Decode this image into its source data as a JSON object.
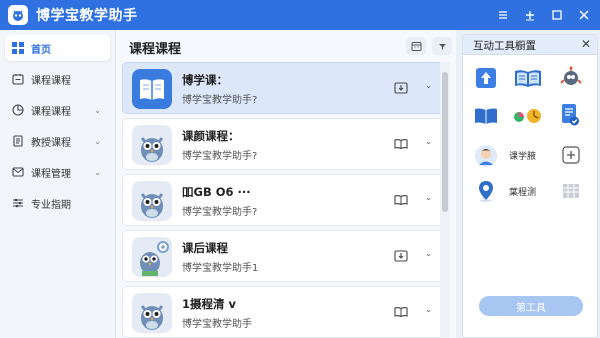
{
  "app": {
    "title": "博学宝教学助手"
  },
  "window_controls": [
    "menu-icon",
    "new-icon",
    "minimize-icon",
    "maximize-icon",
    "close-icon"
  ],
  "sidebar": {
    "items": [
      {
        "label": "首页",
        "icon": "grid-icon",
        "active": true,
        "has_chevron": false
      },
      {
        "label": "课程课程",
        "icon": "calendar-icon",
        "active": false,
        "has_chevron": false
      },
      {
        "label": "课程课程",
        "icon": "pie-chart-icon",
        "active": false,
        "has_chevron": true
      },
      {
        "label": "教授课程",
        "icon": "document-icon",
        "active": false,
        "has_chevron": true
      },
      {
        "label": "课程管理",
        "icon": "mail-icon",
        "active": false,
        "has_chevron": true
      },
      {
        "label": "专业指期",
        "icon": "sliders-icon",
        "active": false,
        "has_chevron": false
      }
    ]
  },
  "main": {
    "title": "课程课程",
    "cards": [
      {
        "title": "博学课：",
        "subtitle": "博学宝教学助手?",
        "thumb": "book-icon",
        "action": "download-icon",
        "active": true
      },
      {
        "title": "课颜课程：",
        "subtitle": "博学宝教学助手?",
        "thumb": "owl-mascot",
        "action": "open-book-icon",
        "active": false
      },
      {
        "title": "吅GB O6 ···",
        "subtitle": "博学宝教学助手?",
        "thumb": "owl-mascot",
        "action": "open-book-icon",
        "active": false
      },
      {
        "title": "课后课程",
        "subtitle": "博学宝教学助手1",
        "thumb": "owl-gear-mascot",
        "action": "download-icon",
        "active": false
      },
      {
        "title": "1摄程清 ⅴ",
        "subtitle": "博学宝教学助手",
        "thumb": "owl-mascot",
        "action": "open-book-icon",
        "active": false
      }
    ]
  },
  "panel": {
    "title": "互动工具橱置",
    "tools": [
      {
        "icon": "upload-arrow-icon"
      },
      {
        "icon": "picture-book-icon"
      },
      {
        "icon": "robot-icon"
      },
      {
        "icon": "open-book-icon"
      },
      {
        "icon": "color-wheel-icon"
      },
      {
        "icon": "checklist-icon"
      },
      {
        "icon": "teacher-avatar-icon",
        "label": "课学腋"
      },
      {
        "icon": "plus-box-icon"
      },
      {
        "icon": "location-pin-icon",
        "label": "葉程测"
      },
      {
        "icon": "grid-tool-icon"
      }
    ],
    "add_button": "第工具"
  },
  "colors": {
    "brand": "#2f71e0",
    "active_card": "#dce8fa",
    "panel_header": "#e2ecfb",
    "add_button": "#a7c6f1"
  }
}
